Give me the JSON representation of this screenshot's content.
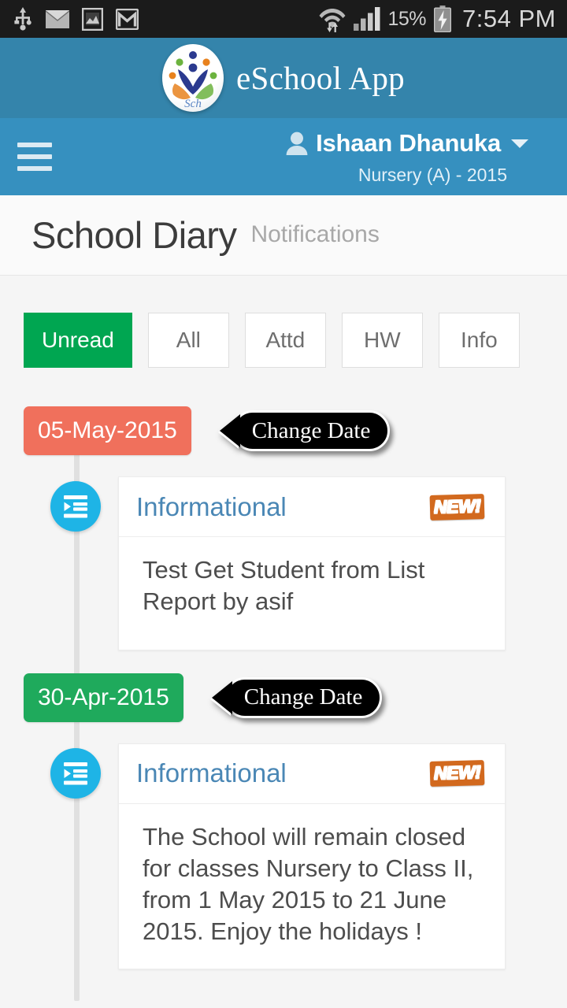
{
  "statusbar": {
    "icons_left": [
      "usb-icon",
      "email-icon",
      "gallery-icon",
      "gmail-icon"
    ],
    "wifi_icon": "wifi-transfer-icon",
    "signal_icon": "cellular-signal-icon",
    "battery_percent": "15%",
    "battery_icon": "battery-charging-icon",
    "clock": "7:54 PM"
  },
  "brand": {
    "logo_icon": "eschool-logo-icon",
    "title": "eSchool App",
    "bar_color": "#3484ab"
  },
  "userbar": {
    "menu_icon": "hamburger-menu-icon",
    "avatar_icon": "user-avatar-icon",
    "user_name": "Ishaan Dhanuka",
    "caret_icon": "chevron-down-icon",
    "class_info": "Nursery (A) - 2015",
    "bar_color": "#3690bf"
  },
  "page": {
    "title": "School Diary",
    "subtitle": "Notifications"
  },
  "filters": {
    "active_color": "#00a651",
    "tabs": [
      {
        "label": "Unread",
        "active": true
      },
      {
        "label": "All",
        "active": false
      },
      {
        "label": "Attd",
        "active": false
      },
      {
        "label": "HW",
        "active": false
      },
      {
        "label": "Info",
        "active": false
      }
    ]
  },
  "timeline": {
    "change_date_label": "Change Date",
    "groups": [
      {
        "date": "05-May-2015",
        "date_color": "#f0705c",
        "entries": [
          {
            "bullet_icon": "indent-list-icon",
            "type": "Informational",
            "badge": "NEW!",
            "text": "Test Get Student from List Report by asif"
          }
        ]
      },
      {
        "date": "30-Apr-2015",
        "date_color": "#1faa5c",
        "entries": [
          {
            "bullet_icon": "indent-list-icon",
            "type": "Informational",
            "badge": "NEW!",
            "text": "The School will remain closed for classes Nursery to Class II, from 1 May 2015 to 21 June 2015. Enjoy the holidays !"
          }
        ]
      }
    ]
  }
}
